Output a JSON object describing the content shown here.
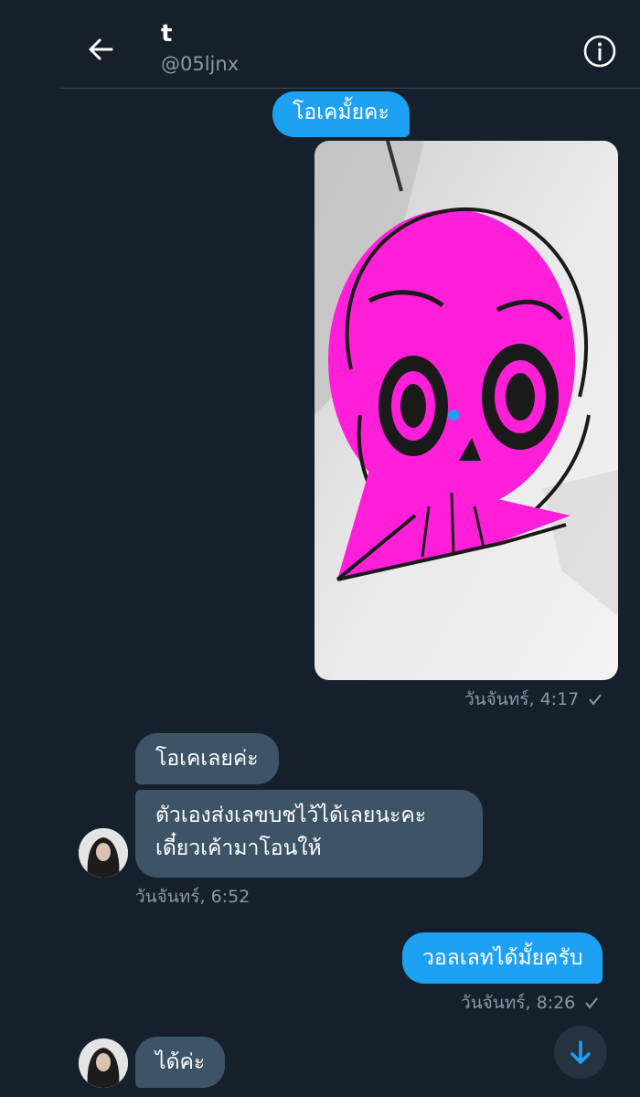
{
  "header": {
    "title": "t",
    "handle": "@05ljnx",
    "back_icon": "arrow-left-icon",
    "info_icon": "info-circle-icon"
  },
  "messages": [
    {
      "text": "โอเคมั้ยคะ",
      "direction": "outgoing"
    },
    {
      "text": "โอเคเลยค่ะ",
      "direction": "incoming"
    },
    {
      "line1": "ตัวเองส่งเลขบชไว้ได้เลยนะคะ",
      "line2": "เดี๋ยวเค้ามาโอนให้",
      "direction": "incoming"
    },
    {
      "text": "วอลเลทได้มั้ยครับ",
      "direction": "outgoing"
    },
    {
      "text": "ได้ค่ะ",
      "direction": "incoming"
    }
  ],
  "timestamps": {
    "t1": "วันจันทร์, 4:17",
    "t2": "วันจันทร์, 6:52",
    "t3": "วันจันทร์, 8:26"
  },
  "icons": {
    "read_check": "checkmark-icon",
    "scroll_down": "arrow-down-icon"
  },
  "colors": {
    "background": "#15202b",
    "outgoing_bubble": "#1da1f2",
    "incoming_bubble": "#3d5466",
    "secondary_text": "#8899a6"
  }
}
